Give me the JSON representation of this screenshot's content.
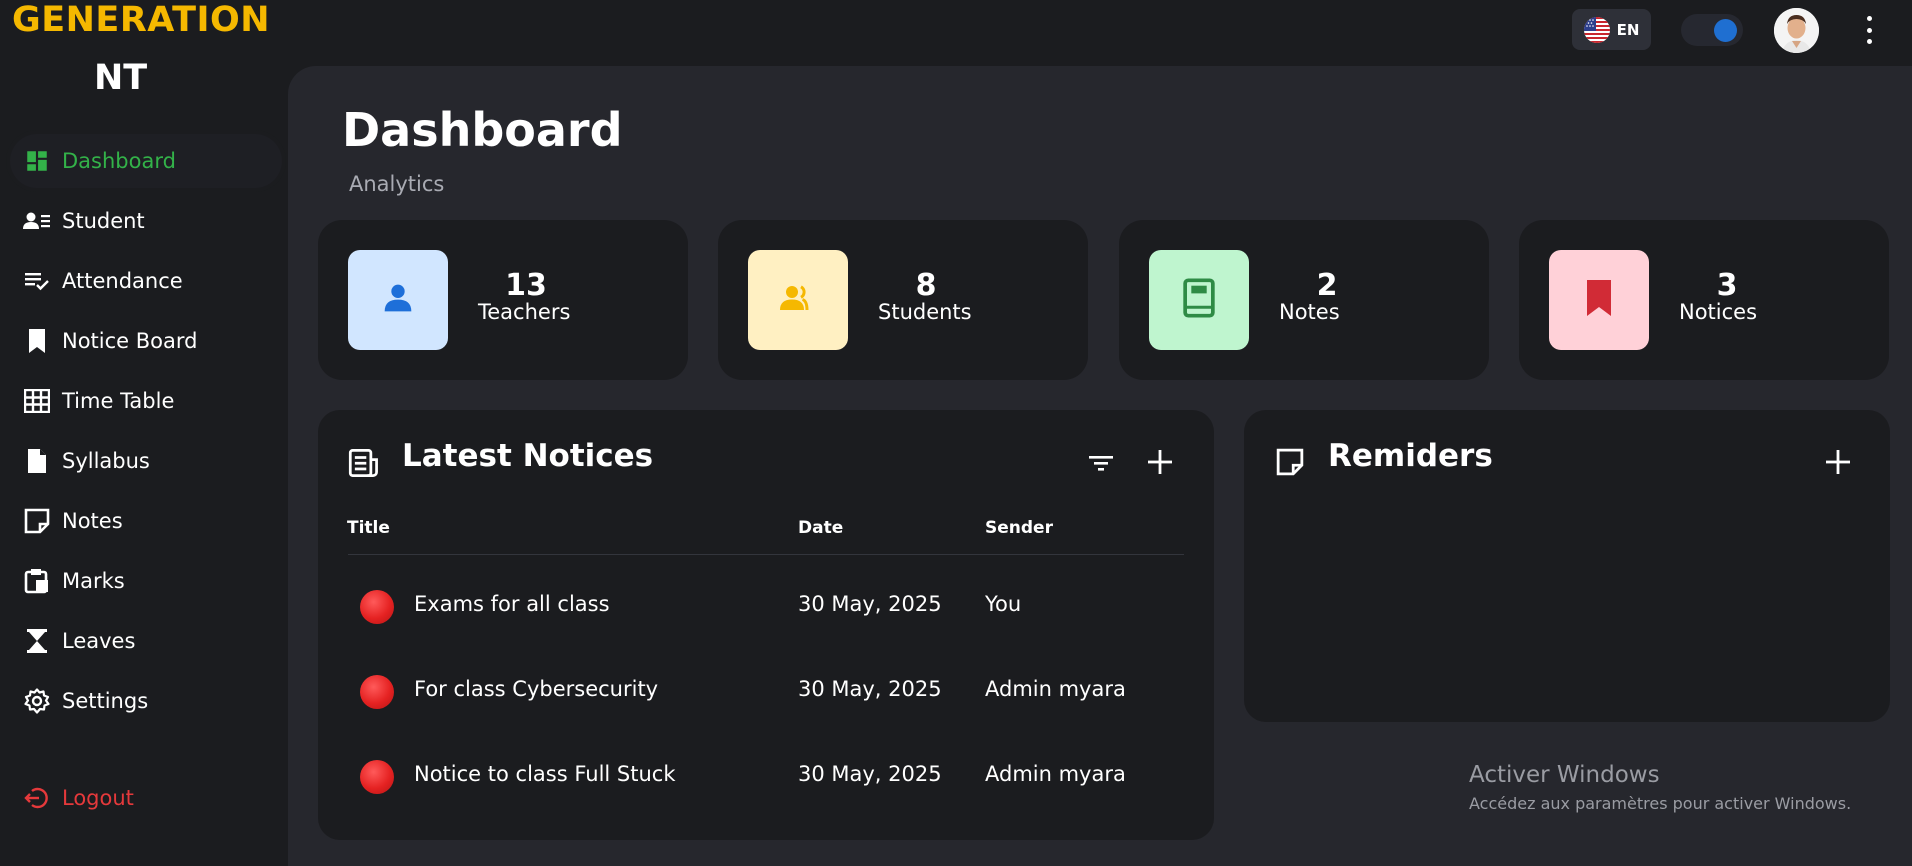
{
  "brand": {
    "line1": "GENERATION",
    "line2": "NT"
  },
  "header": {
    "language_code": "EN",
    "theme_toggle_on": true
  },
  "sidebar": {
    "items": [
      {
        "label": "Dashboard",
        "icon": "dashboard-icon",
        "active": true
      },
      {
        "label": "Student",
        "icon": "student-list-icon"
      },
      {
        "label": "Attendance",
        "icon": "attendance-check-icon"
      },
      {
        "label": "Notice Board",
        "icon": "bookmark-icon"
      },
      {
        "label": "Time Table",
        "icon": "grid-table-icon"
      },
      {
        "label": "Syllabus",
        "icon": "document-icon"
      },
      {
        "label": "Notes",
        "icon": "sticky-note-icon"
      },
      {
        "label": "Marks",
        "icon": "clipboard-icon"
      },
      {
        "label": "Leaves",
        "icon": "hourglass-icon"
      },
      {
        "label": "Settings",
        "icon": "gear-icon"
      }
    ],
    "logout": {
      "label": "Logout",
      "icon": "logout-icon"
    }
  },
  "page": {
    "title": "Dashboard",
    "subtitle": "Analytics"
  },
  "stats": [
    {
      "count": "13",
      "label": "Teachers",
      "icon": "person-icon",
      "bg": "#d1e6ff",
      "fg": "#1e6fd9"
    },
    {
      "count": "8",
      "label": "Students",
      "icon": "group-icon",
      "bg": "#fff0c2",
      "fg": "#f5b800"
    },
    {
      "count": "2",
      "label": "Notes",
      "icon": "book-icon",
      "bg": "#bff5cf",
      "fg": "#2e8b45"
    },
    {
      "count": "3",
      "label": "Notices",
      "icon": "bookmark-icon",
      "bg": "#ffd1d8",
      "fg": "#d12b36"
    }
  ],
  "notices": {
    "title": "Latest Notices",
    "columns": {
      "title": "Title",
      "date": "Date",
      "sender": "Sender"
    },
    "rows": [
      {
        "title": "Exams for all class",
        "date": "30 May, 2025",
        "sender": "You"
      },
      {
        "title": "For class Cybersecurity",
        "date": "30 May, 2025",
        "sender": "Admin myara"
      },
      {
        "title": "Notice to class Full Stuck",
        "date": "30 May, 2025",
        "sender": "Admin myara"
      }
    ]
  },
  "reminders": {
    "title": "Remiders"
  },
  "watermark": {
    "title": "Activer Windows",
    "subtitle": "Accédez aux paramètres pour activer Windows."
  },
  "colors": {
    "accent_green": "#33b249",
    "brand_yellow": "#f5b800",
    "danger_red": "#e5393b",
    "toggle_blue": "#1f6fd1"
  }
}
